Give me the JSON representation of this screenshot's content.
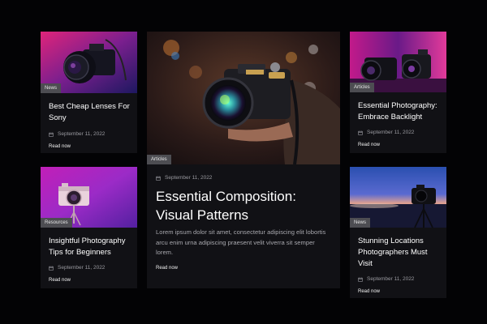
{
  "colors": {
    "page_bg": "#030305",
    "card_bg": "#111115",
    "badge_bg": "#4d4d52",
    "muted_text": "#9a9aa0"
  },
  "cards": {
    "lenses": {
      "category": "News",
      "title": "Best Cheap Lenses For Sony",
      "date": "September 11, 2022",
      "read_more": "Read now",
      "image": "camera-lens-purple-photo"
    },
    "featured": {
      "category": "Articles",
      "date": "September 11, 2022",
      "title": "Essential Composition: Visual Patterns",
      "excerpt": "Lorem ipsum dolor sit amet, consectetur adipiscing elit lobortis arcu enim urna adipiscing praesent velit viverra sit semper lorem.",
      "read_more": "Read now",
      "image": "hand-holding-fujifilm-camera-photo"
    },
    "backlight": {
      "category": "Articles",
      "title": "Essential Photography: Embrace Backlight",
      "date": "September 11, 2022",
      "read_more": "Read now",
      "image": "cameras-pink-backlight-photo"
    },
    "beginners": {
      "category": "Resources",
      "title": "Insightful Photography Tips for Beginners",
      "date": "September 11, 2022",
      "read_more": "Read now",
      "image": "pink-retro-camera-photo"
    },
    "locations": {
      "category": "News",
      "title": "Stunning Locations Photographers Must Visit",
      "date": "September 11, 2022",
      "read_more": "Read now",
      "image": "camera-on-tripod-sunset-photo"
    }
  }
}
